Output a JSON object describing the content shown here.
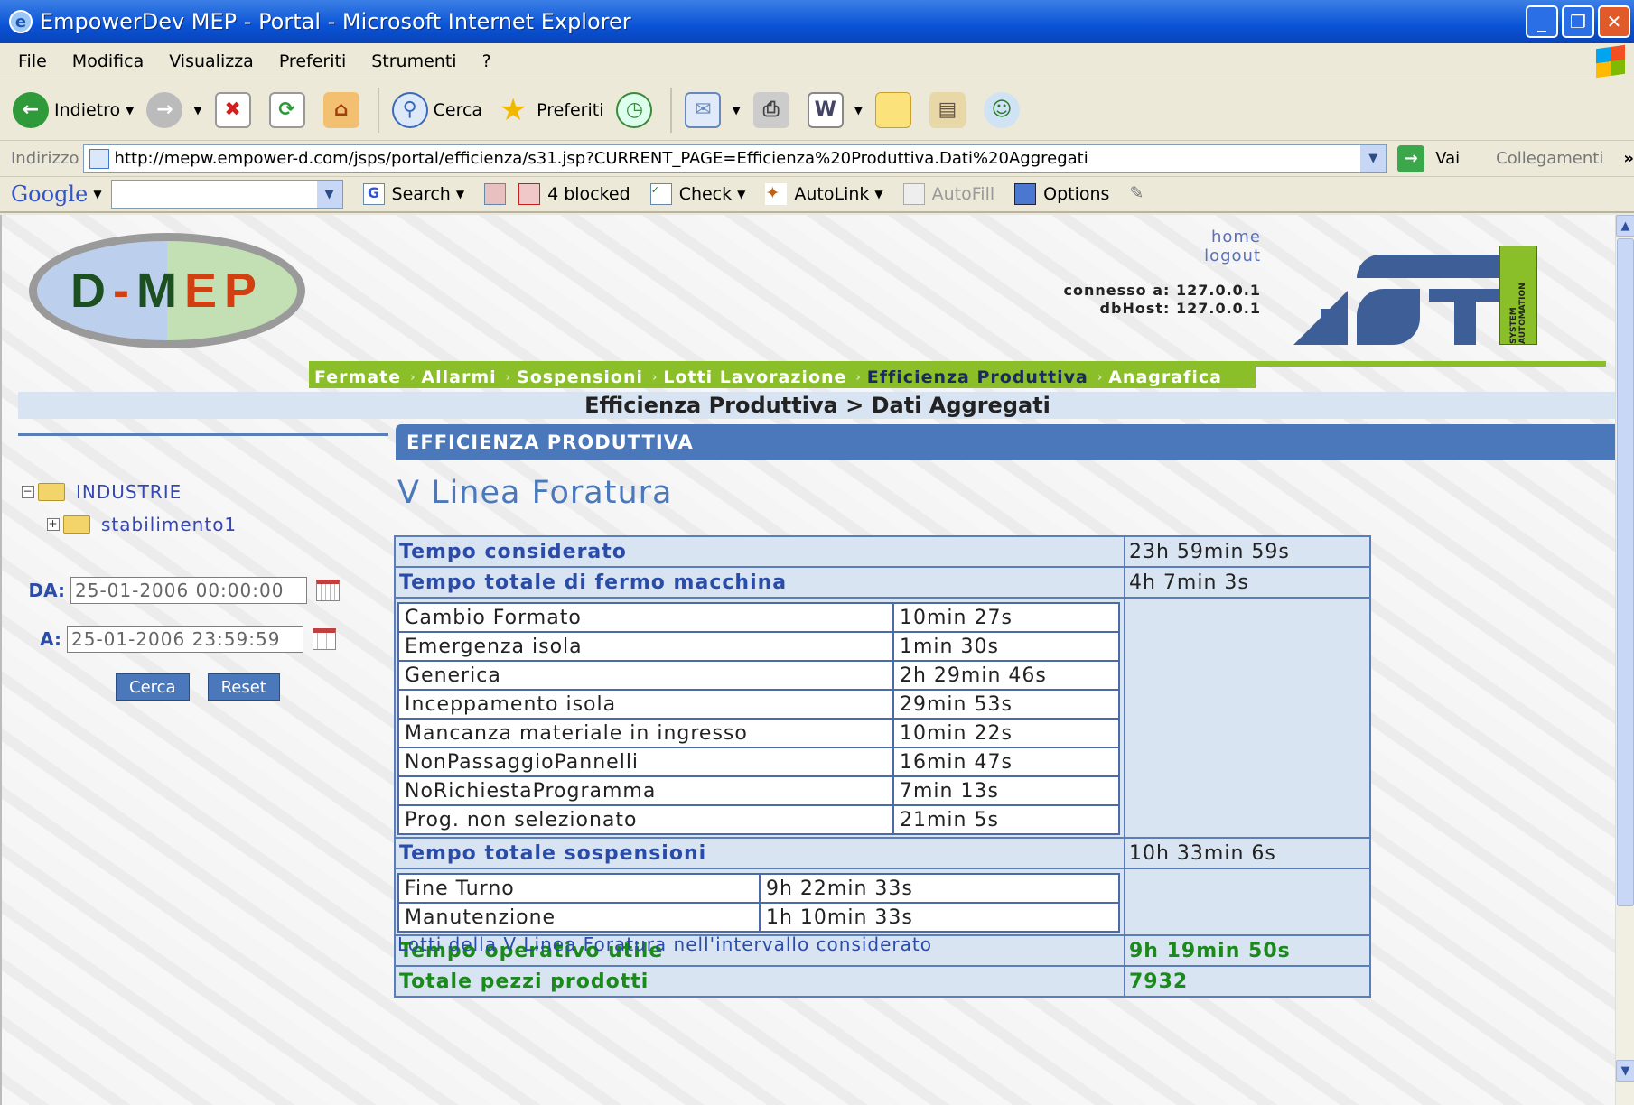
{
  "window": {
    "title": "EmpowerDev MEP - Portal - Microsoft Internet Explorer",
    "minimize": "_",
    "restore": "❐",
    "close": "✕"
  },
  "menu": [
    "File",
    "Modifica",
    "Visualizza",
    "Preferiti",
    "Strumenti",
    "?"
  ],
  "toolbar": {
    "back": "Indietro",
    "search": "Cerca",
    "favorites": "Preferiti"
  },
  "address": {
    "label": "Indirizzo",
    "url": "http://mepw.empower-d.com/jsps/portal/efficienza/s31.jsp?CURRENT_PAGE=Efficienza%20Produttiva.Dati%20Aggregati",
    "go": "Vai",
    "links": "Collegamenti"
  },
  "google": {
    "logo": "Google",
    "search": "Search",
    "blocked": "4 blocked",
    "check": "Check",
    "autolink": "AutoLink",
    "autofill": "AutoFill",
    "options": "Options"
  },
  "header": {
    "logo": {
      "d1": "D",
      "d2": "-",
      "d3": "M",
      "d4": "E",
      "d5": "P"
    },
    "home": "home",
    "logout": "logout",
    "connected": "connesso a: 127.0.0.1",
    "dbhost": "dbHost: 127.0.0.1",
    "brand_tag": "SYSTEM AUTOMATION"
  },
  "nav": [
    "Fermate",
    "Allarmi",
    "Sospensioni",
    "Lotti Lavorazione",
    "Efficienza Produttiva",
    "Anagrafica"
  ],
  "breadcrumb": "Efficienza Produttiva > Dati Aggregati",
  "section_header": "EFFICIENZA PRODUTTIVA",
  "tree": {
    "root": "INDUSTRIE",
    "child": "stabilimento1"
  },
  "filter": {
    "da_label": "DA:",
    "da_value": "25-01-2006 00:00:00",
    "a_label": "A:",
    "a_value": "25-01-2006 23:59:59",
    "search": "Cerca",
    "reset": "Reset"
  },
  "page_title": "V Linea Foratura",
  "stats": {
    "tempo_considerato": {
      "label": "Tempo considerato",
      "value": "23h 59min 59s"
    },
    "fermo": {
      "label": "Tempo totale di fermo macchina",
      "value": "4h 7min 3s"
    },
    "fermo_rows": [
      {
        "name": "Cambio Formato",
        "value": "10min 27s"
      },
      {
        "name": "Emergenza isola",
        "value": "1min 30s"
      },
      {
        "name": "Generica",
        "value": "2h 29min 46s"
      },
      {
        "name": "Inceppamento isola",
        "value": "29min 53s"
      },
      {
        "name": "Mancanza materiale in ingresso",
        "value": "10min 22s"
      },
      {
        "name": "NonPassaggioPannelli",
        "value": "16min 47s"
      },
      {
        "name": "NoRichiestaProgramma",
        "value": "7min 13s"
      },
      {
        "name": "Prog. non selezionato",
        "value": "21min 5s"
      }
    ],
    "sospensioni": {
      "label": "Tempo totale sospensioni",
      "value": "10h 33min 6s"
    },
    "sosp_rows": [
      {
        "name": "Fine Turno",
        "value": "9h 22min 33s"
      },
      {
        "name": "Manutenzione",
        "value": "1h 10min 33s"
      }
    ],
    "operativo": {
      "label": "Tempo operativo utile",
      "value": "9h 19min 50s"
    },
    "pezzi": {
      "label": "Totale pezzi prodotti",
      "value": "7932"
    }
  },
  "footer_link": "Lotti della V Linea Foratura nell'intervallo considerato"
}
